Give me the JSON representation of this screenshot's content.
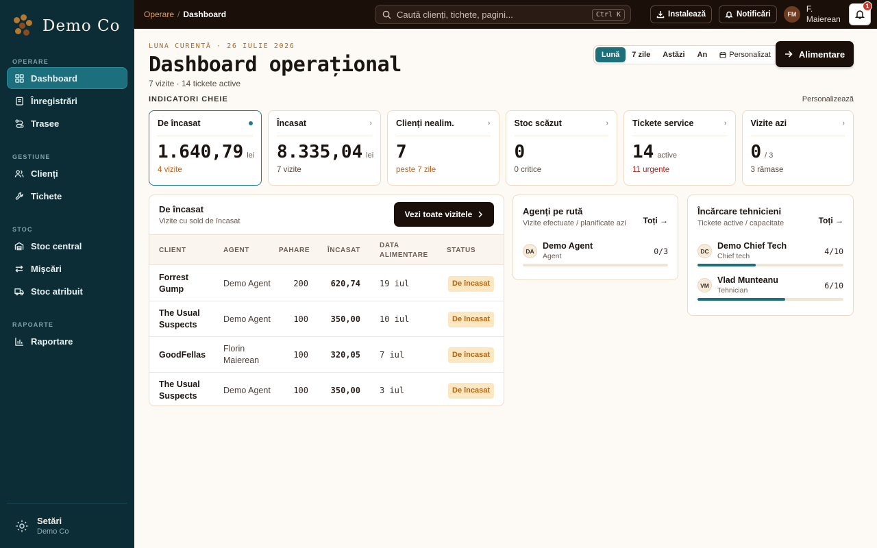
{
  "brand": {
    "name": "Demo Co"
  },
  "sidebar": {
    "sections": [
      {
        "label": "OPERARE",
        "items": [
          {
            "label": "Dashboard",
            "icon": "dashboard-icon",
            "active": true
          },
          {
            "label": "Înregistrări",
            "icon": "clipboard-icon"
          },
          {
            "label": "Trasee",
            "icon": "route-icon"
          }
        ]
      },
      {
        "label": "GESTIUNE",
        "items": [
          {
            "label": "Clienți",
            "icon": "users-icon"
          },
          {
            "label": "Tichete",
            "icon": "wrench-icon"
          }
        ]
      },
      {
        "label": "STOC",
        "items": [
          {
            "label": "Stoc central",
            "icon": "warehouse-icon"
          },
          {
            "label": "Mișcări",
            "icon": "transfer-icon"
          },
          {
            "label": "Stoc atribuit",
            "icon": "truck-icon"
          }
        ]
      },
      {
        "label": "RAPOARTE",
        "items": [
          {
            "label": "Raportare",
            "icon": "bar-chart-icon"
          }
        ]
      }
    ],
    "footer": {
      "title": "Setări",
      "subtitle": "Demo Co"
    }
  },
  "topbar": {
    "breadcrumb": {
      "parent": "Operare",
      "separator": "/",
      "current": "Dashboard"
    },
    "search": {
      "placeholder": "Caută clienți, tichete, pagini...",
      "shortcut": "Ctrl K"
    },
    "install_label": "Instalează",
    "notifications_label": "Notificări",
    "user": {
      "initials": "FM",
      "name_line1": "F.",
      "name_line2": "Maierean"
    },
    "bell_badge": "1"
  },
  "header": {
    "eyebrow": "LUNA CURENTĂ · 26 IULIE 2026",
    "title": "Dashboard operațional",
    "subtitle": "7 vizite · 14 tickete active",
    "period_tabs": [
      "Lună",
      "7 zile",
      "Astăzi",
      "An",
      "Personalizat"
    ],
    "active_period": "Lună",
    "primary_action": "Alimentare"
  },
  "kpi": {
    "section_label": "INDICATORI CHEIE",
    "customize_label": "Personalizează",
    "cards": [
      {
        "title": "De încasat",
        "value": "1.640,79",
        "unit": "lei",
        "foot": "4 vizite",
        "foot_tone": "orange",
        "active": true
      },
      {
        "title": "Încasat",
        "value": "8.335,04",
        "unit": "lei",
        "foot": "7 vizite",
        "foot_tone": "muted"
      },
      {
        "title": "Clienți nealim.",
        "value": "7",
        "unit": "",
        "foot": "peste 7 zile",
        "foot_tone": "orange"
      },
      {
        "title": "Stoc scăzut",
        "value": "0",
        "unit": "",
        "foot": "0 critice",
        "foot_tone": "muted"
      },
      {
        "title": "Tickete service",
        "value": "14",
        "unit": "active",
        "foot": "11 urgente",
        "foot_tone": "red"
      },
      {
        "title": "Vizite azi",
        "value": "0",
        "unit": "/ 3",
        "foot": "3 rămase",
        "foot_tone": "muted"
      }
    ]
  },
  "receivables": {
    "title": "De încasat",
    "subtitle": "Vizite cu sold de încasat",
    "button_label": "Vezi toate vizitele",
    "columns": [
      "CLIENT",
      "AGENT",
      "PAHARE",
      "ÎNCASAT",
      "DATA ALIMENTARE",
      "STATUS"
    ],
    "rows": [
      {
        "client": "Forrest Gump",
        "agent": "Demo Agent",
        "pahare": "200",
        "incasat": "620,74",
        "data": "19 iul",
        "status": "De încasat"
      },
      {
        "client": "The Usual Suspects",
        "agent": "Demo Agent",
        "pahare": "100",
        "incasat": "350,00",
        "data": "10 iul",
        "status": "De încasat"
      },
      {
        "client": "GoodFellas",
        "agent": "Florin Maierean",
        "pahare": "100",
        "incasat": "320,05",
        "data": "7 iul",
        "status": "De încasat"
      },
      {
        "client": "The Usual Suspects",
        "agent": "Demo Agent",
        "pahare": "100",
        "incasat": "350,00",
        "data": "3 iul",
        "status": "De încasat"
      }
    ]
  },
  "agents": {
    "title": "Agenți pe rută",
    "subtitle": "Vizite efectuate / planificate azi",
    "all_label": "Toți →",
    "people": [
      {
        "initials": "DA",
        "name": "Demo Agent",
        "role": "Agent",
        "count": "0/3",
        "progress": 0
      }
    ]
  },
  "techs": {
    "title": "Încărcare tehnicieni",
    "subtitle": "Tickete active / capacitate",
    "all_label": "Toți →",
    "people": [
      {
        "initials": "DC",
        "name": "Demo Chief Tech",
        "role": "Chief tech",
        "count": "4/10",
        "progress": 0.4
      },
      {
        "initials": "VM",
        "name": "Vlad Munteanu",
        "role": "Tehnician",
        "count": "6/10",
        "progress": 0.6
      }
    ]
  },
  "colors": {
    "sidebar": "#0c2d36",
    "accent": "#1d6f7b",
    "topbar": "#1b0f0a",
    "warning": "#c0621a",
    "danger": "#b3261e"
  }
}
